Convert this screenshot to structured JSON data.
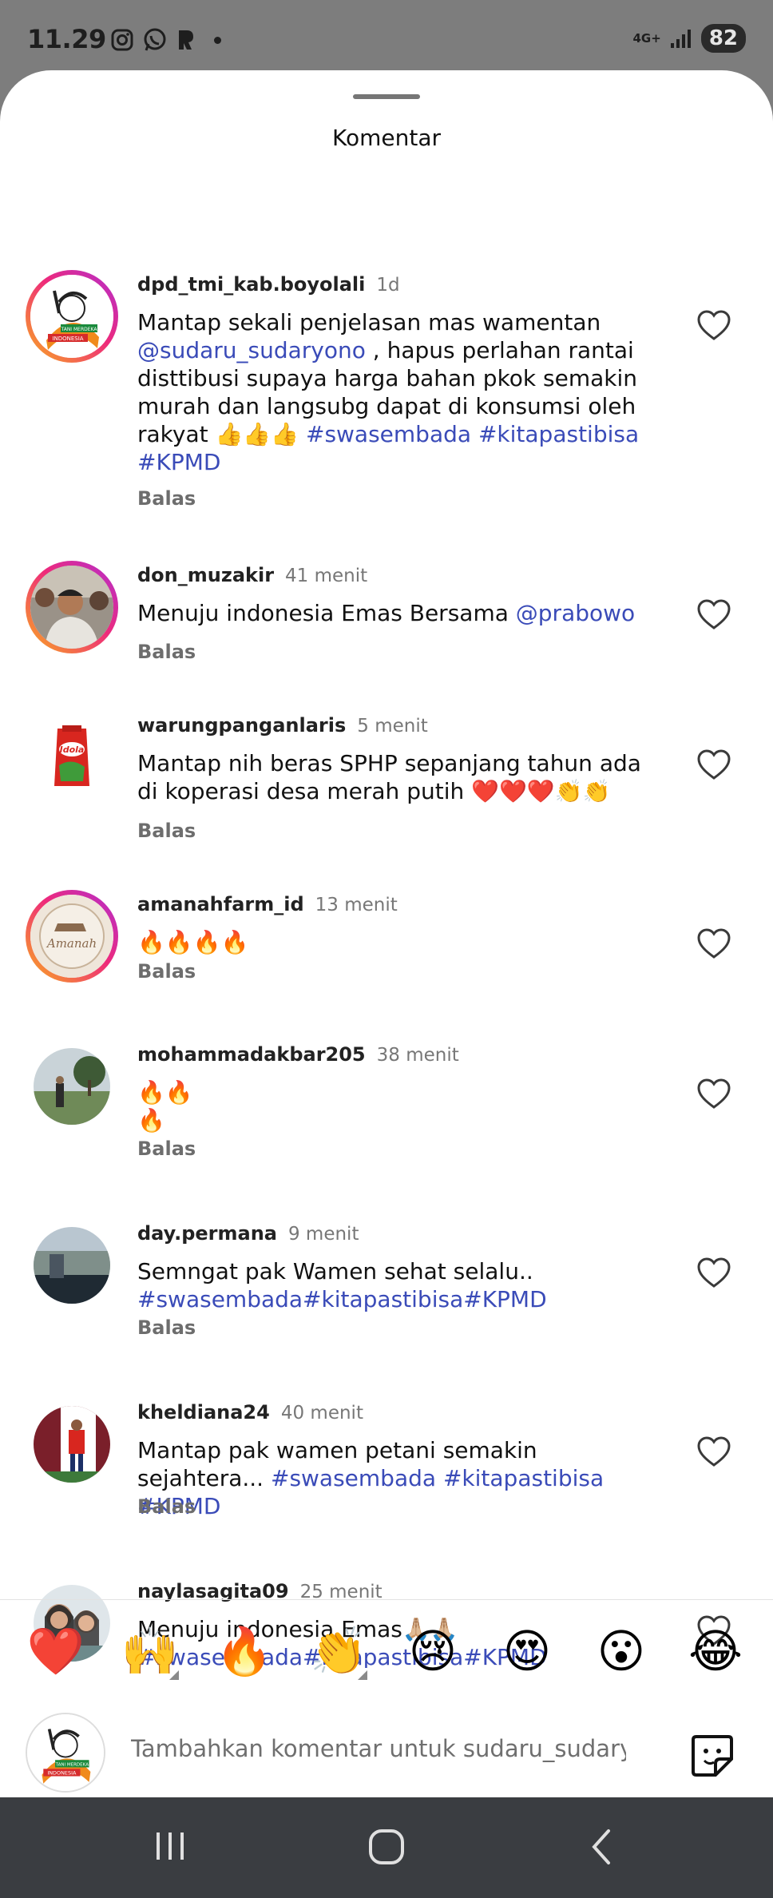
{
  "status_bar": {
    "time": "11.29",
    "network": "4G+",
    "battery": "82"
  },
  "sheet": {
    "title": "Komentar"
  },
  "comments": [
    {
      "user": "dpd_tmi_kab.boyolali",
      "time": "1d",
      "text_parts": [
        {
          "t": "Mantap sekali penjelasan mas wamentan ",
          "link": false
        },
        {
          "t": "@sudaru_sudaryono",
          "link": true
        },
        {
          "t": " ,  hapus perlahan rantai disttibusi supaya harga bahan pkok semakin murah dan langsubg dapat di konsumsi oleh rakyat 👍👍👍 ",
          "link": false
        },
        {
          "t": "#swasembada",
          "link": true
        },
        {
          "t": "  ",
          "link": false
        },
        {
          "t": "#kitapastibisa",
          "link": true
        },
        {
          "t": " ",
          "link": false
        },
        {
          "t": "#KPMD",
          "link": true
        }
      ],
      "reply": "Balas"
    },
    {
      "user": "don_muzakir",
      "time": "41 menit",
      "text_parts": [
        {
          "t": "Menuju indonesia Emas Bersama ",
          "link": false
        },
        {
          "t": "@prabowo",
          "link": true
        }
      ],
      "reply": "Balas"
    },
    {
      "user": "warungpanganlaris",
      "time": "5 menit",
      "text_parts": [
        {
          "t": "Mantap nih beras SPHP sepanjang tahun ada di koperasi desa merah putih ❤️❤️❤️👏👏",
          "link": false
        }
      ],
      "reply": "Balas"
    },
    {
      "user": "amanahfarm_id",
      "time": "13 menit",
      "text_parts": [
        {
          "t": "🔥🔥🔥🔥",
          "link": false
        }
      ],
      "reply": "Balas"
    },
    {
      "user": "mohammadakbar205",
      "time": "38 menit",
      "text_parts": [
        {
          "t": "🔥🔥\n🔥",
          "link": false
        }
      ],
      "reply": "Balas"
    },
    {
      "user": "day.permana",
      "time": "9 menit",
      "text_parts": [
        {
          "t": "Semngat pak Wamen sehat selalu.. ",
          "link": false
        },
        {
          "t": "#swasembada#kitapastibisa#KPMD",
          "link": true
        }
      ],
      "reply": "Balas"
    },
    {
      "user": "kheldiana24",
      "time": "40 menit",
      "text_parts": [
        {
          "t": "Mantap pak wamen petani semakin sejahtera... ",
          "link": false
        },
        {
          "t": "#swasembada",
          "link": true
        },
        {
          "t": " ",
          "link": false
        },
        {
          "t": "#kitapastibisa",
          "link": true
        },
        {
          "t": " ",
          "link": false
        },
        {
          "t": "#KPMD",
          "link": true
        }
      ],
      "reply": "Balas"
    },
    {
      "user": "naylasagita09",
      "time": "25 menit",
      "text_parts": [
        {
          "t": "Menuju indonesia Emas🙏🏼🙏🏼 ",
          "link": false
        },
        {
          "t": "#swasembada#kitapastibisa#KPMD",
          "link": true
        }
      ],
      "reply": ""
    }
  ],
  "avatar_labels": {
    "tani": "TANI MERDEKA",
    "indonesia": "INDONESIA",
    "amanah": "Amanah",
    "idola": "Idola"
  },
  "emoji_bar": [
    "❤️",
    "🙌",
    "🔥",
    "👏",
    "😢",
    "😍",
    "😮",
    "😂"
  ],
  "add_comment": {
    "placeholder": "Tambahkan komentar untuk sudaru_sudaryono"
  },
  "colors": {
    "link": "#3a4bb8",
    "ring_start": "#f9ae1e",
    "ring_mid": "#ee2a7b",
    "ring_end": "#b12fd1"
  },
  "icons": {
    "heart": "heart-outline-icon",
    "sticker": "sticker-icon"
  }
}
